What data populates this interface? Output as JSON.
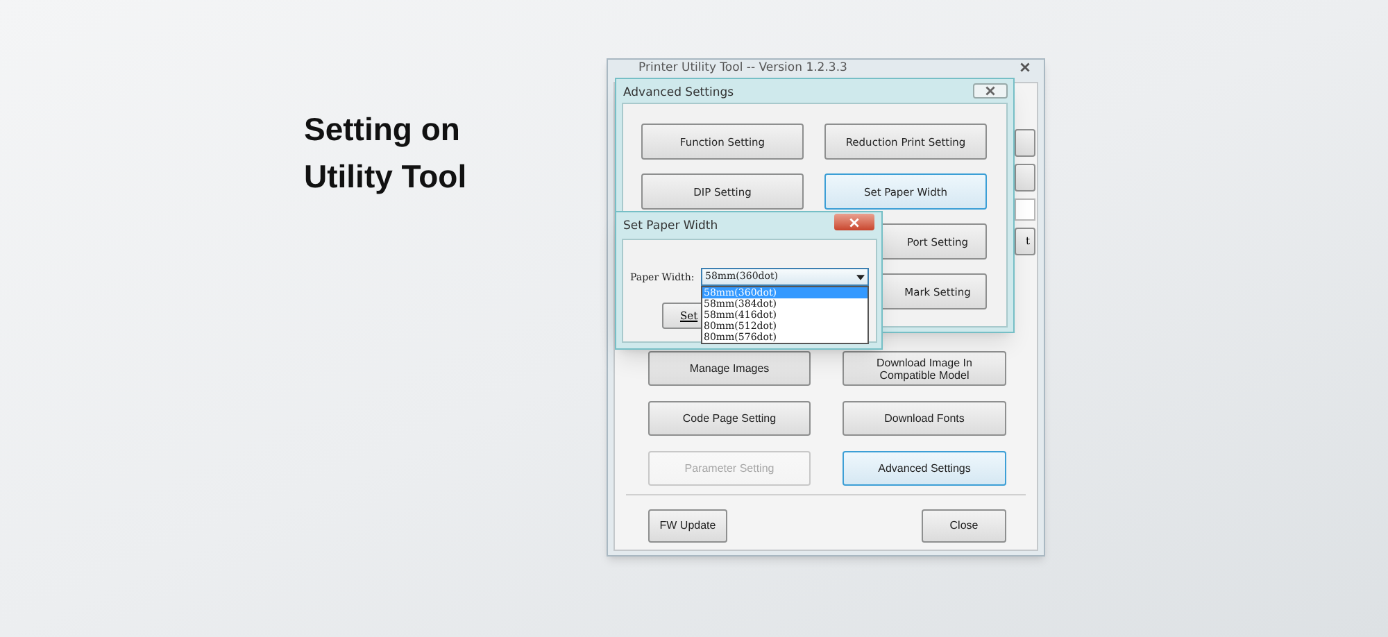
{
  "heading": "Setting on Utility Tool",
  "main_window": {
    "title": "Printer Utility Tool -- Version 1.2.3.3",
    "side_fragments": [
      {
        "kind": "button"
      },
      {
        "kind": "button"
      },
      {
        "kind": "field"
      },
      {
        "kind": "button",
        "text": "t"
      }
    ],
    "buttons": [
      {
        "label": "Manage Images",
        "disabled": false,
        "focused": false
      },
      {
        "label": "Download Image In Compatible Model",
        "disabled": false,
        "focused": false
      },
      {
        "label": "Code Page Setting",
        "disabled": false,
        "focused": false
      },
      {
        "label": "Download Fonts",
        "disabled": false,
        "focused": false
      },
      {
        "label": "Parameter Setting",
        "disabled": true,
        "focused": false
      },
      {
        "label": "Advanced Settings",
        "disabled": false,
        "focused": true
      }
    ],
    "footer_buttons": [
      {
        "label": "FW Update"
      },
      {
        "label": "Close"
      }
    ]
  },
  "advanced_dialog": {
    "title": "Advanced Settings",
    "left_buttons": [
      {
        "label": "Function Setting",
        "focused": false
      },
      {
        "label": "DIP Setting",
        "focused": false
      }
    ],
    "right_buttons": [
      {
        "label": "Reduction Print Setting",
        "focused": false
      },
      {
        "label": "Set Paper Width",
        "focused": true
      },
      {
        "label": "Port Setting",
        "focused": false
      },
      {
        "label": "Mark Setting",
        "focused": false
      }
    ]
  },
  "paper_dialog": {
    "title": "Set Paper Width",
    "field_label": "Paper Width:",
    "value": "58mm(360dot)",
    "options": [
      {
        "label": "58mm(360dot)",
        "selected": true
      },
      {
        "label": "58mm(384dot)",
        "selected": false
      },
      {
        "label": "58mm(416dot)",
        "selected": false
      },
      {
        "label": "80mm(512dot)",
        "selected": false
      },
      {
        "label": "80mm(576dot)",
        "selected": false
      }
    ],
    "button": "Set"
  }
}
